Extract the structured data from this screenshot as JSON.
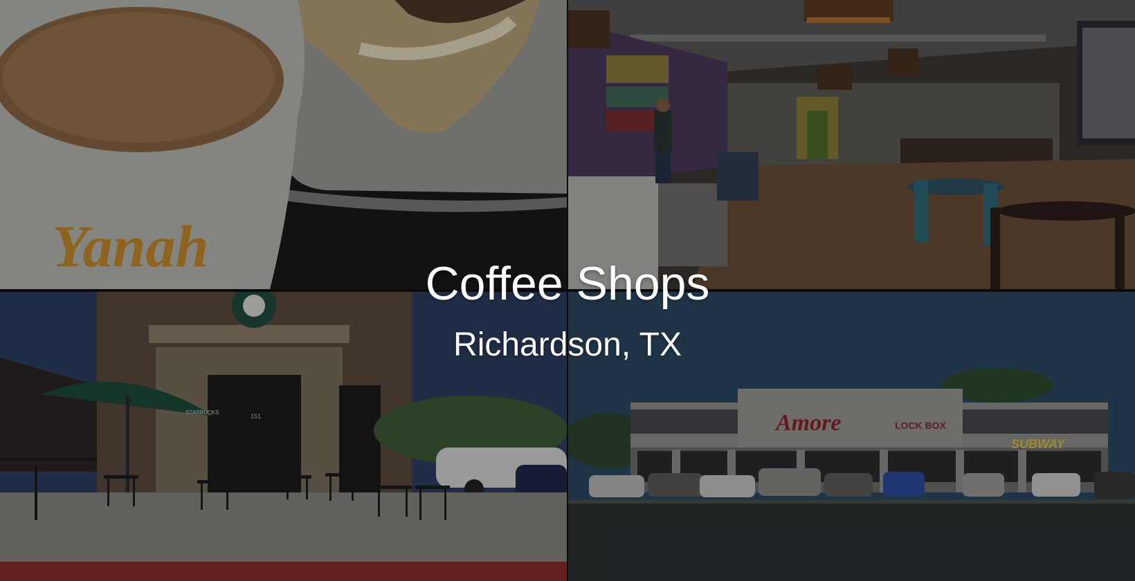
{
  "banner": {
    "title": "Coffee Shops",
    "subtitle": "Richardson, TX"
  },
  "photos": [
    {
      "subject": "coffee-cup-and-pastry",
      "cup_logo": "Yanah"
    },
    {
      "subject": "cafe-interior"
    },
    {
      "subject": "starbucks-storefront-patio",
      "umbrella_text": "STARBUCKS",
      "address_number": "151"
    },
    {
      "subject": "strip-mall-storefronts",
      "signs": [
        "Amore",
        "LOCK BOX",
        "SUBWAY"
      ]
    }
  ]
}
